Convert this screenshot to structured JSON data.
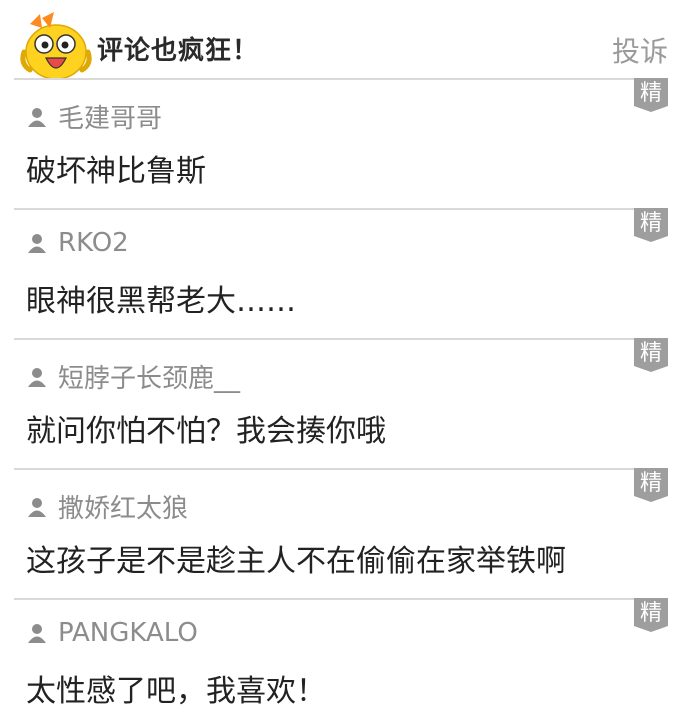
{
  "header": {
    "title": "评论也疯狂！",
    "report_label": "投诉"
  },
  "badge_text": "精",
  "colors": {
    "title": "#2a2a2a",
    "report": "#9a9a9a",
    "username": "#8c8c8c",
    "comment": "#222222",
    "divider": "#d9d9d9",
    "badge_bg": "#9e9e9e",
    "mascot_yellow": "#ffd21f"
  },
  "comments": [
    {
      "username": "毛建哥哥",
      "text": "破坏神比鲁斯"
    },
    {
      "username": "RKO2",
      "text": "眼神很黑帮老大……"
    },
    {
      "username": "短脖子长颈鹿__",
      "text": "就问你怕不怕？我会揍你哦"
    },
    {
      "username": "撒娇红太狼",
      "text": "这孩子是不是趁主人不在偷偷在家举铁啊"
    },
    {
      "username": "PANGKALO",
      "text": "太性感了吧，我喜欢！"
    }
  ]
}
